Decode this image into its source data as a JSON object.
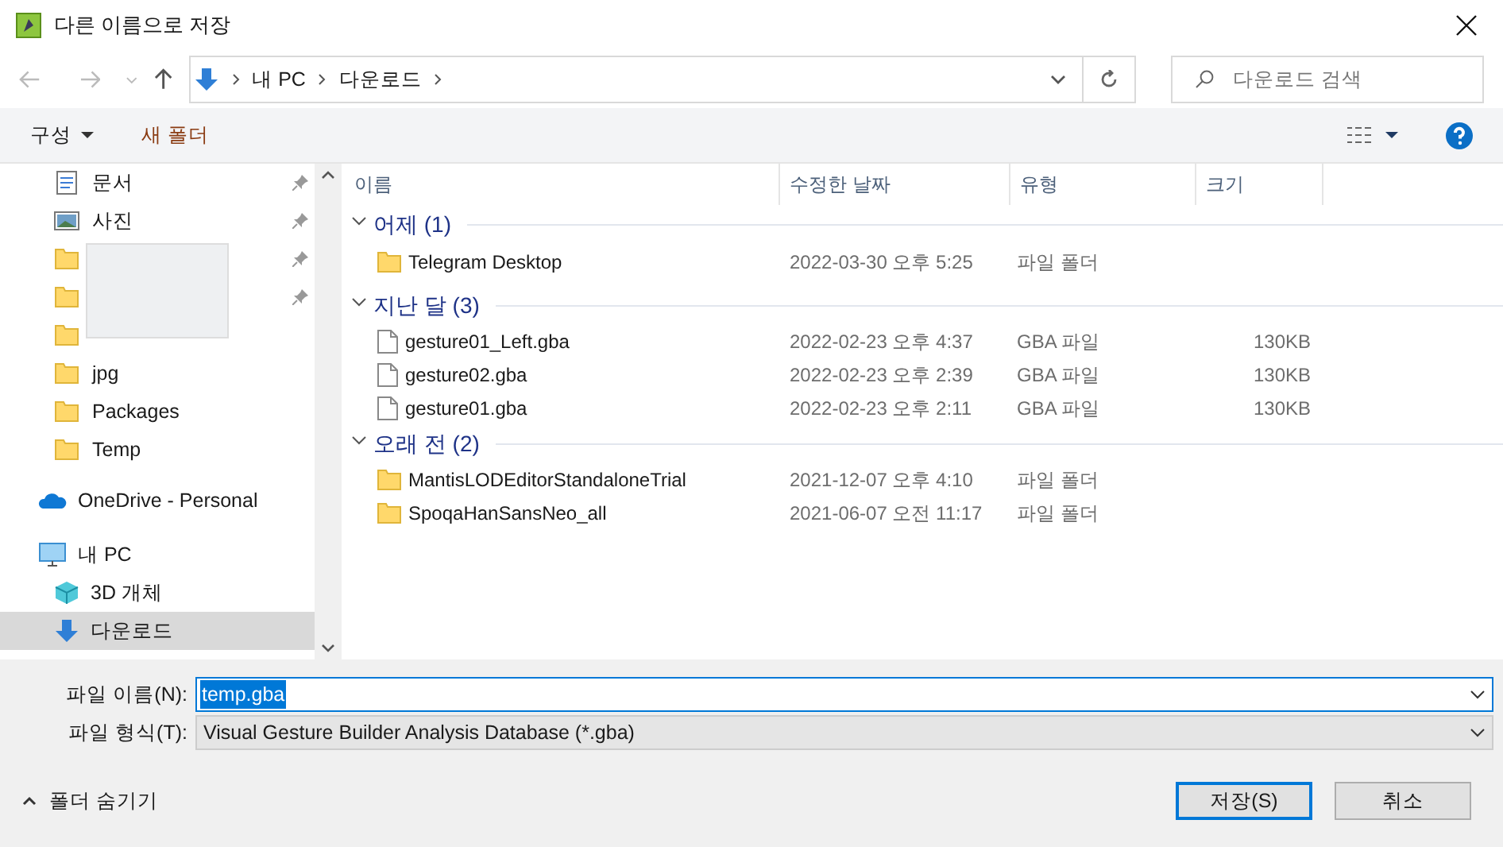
{
  "window": {
    "title": "다른 이름으로 저장"
  },
  "address_bar": {
    "path": [
      "내 PC",
      "다운로드"
    ]
  },
  "search": {
    "placeholder": "다운로드 검색"
  },
  "toolbar": {
    "organize": "구성",
    "new_folder": "새 폴더"
  },
  "quick_access": [
    {
      "label": "문서",
      "kind": "documents",
      "pinned": true
    },
    {
      "label": "사진",
      "kind": "pictures",
      "pinned": true
    },
    {
      "kind": "folder",
      "pinned": true
    },
    {
      "kind": "folder",
      "pinned": true
    },
    {
      "kind": "folder",
      "pinned": false
    },
    {
      "label": "jpg",
      "kind": "folder",
      "pinned": false
    },
    {
      "label": "Packages",
      "kind": "folder",
      "pinned": false
    },
    {
      "label": "Temp",
      "kind": "folder",
      "pinned": false
    }
  ],
  "sidebar": {
    "items": [
      {
        "label": "OneDrive - Personal",
        "kind": "cloud",
        "selected": false
      },
      {
        "label": "내 PC",
        "kind": "pc",
        "selected": false,
        "children": [
          {
            "label": "3D 개체",
            "kind": "cube",
            "selected": false
          },
          {
            "label": "다운로드",
            "kind": "download",
            "selected": true
          }
        ]
      }
    ]
  },
  "table": {
    "columns": [
      "이름",
      "수정한 날짜",
      "유형",
      "크기"
    ],
    "groups": [
      {
        "title": "어제 (1)",
        "expanded": true,
        "rows": [
          {
            "name": "Telegram Desktop",
            "kind": "folder",
            "date": "2022-03-30 오후 5:25",
            "type": "파일 폴더"
          }
        ]
      },
      {
        "title": "지난 달 (3)",
        "expanded": true,
        "rows": [
          {
            "name": "gesture01_Left.gba",
            "kind": "file",
            "date": "2022-02-23 오후 4:37",
            "type": "GBA 파일",
            "size": "130KB"
          },
          {
            "name": "gesture02.gba",
            "kind": "file",
            "date": "2022-02-23 오후 2:39",
            "type": "GBA 파일",
            "size": "130KB"
          },
          {
            "name": "gesture01.gba",
            "kind": "file",
            "date": "2022-02-23 오후 2:11",
            "type": "GBA 파일",
            "size": "130KB"
          }
        ]
      },
      {
        "title": "오래 전 (2)",
        "expanded": true,
        "rows": [
          {
            "name": "MantisLODEditorStandaloneTrial",
            "kind": "folder",
            "date": "2021-12-07 오후 4:10",
            "type": "파일 폴더"
          },
          {
            "name": "SpoqaHanSansNeo_all",
            "kind": "folder",
            "date": "2021-06-07 오전 11:17",
            "type": "파일 폴더"
          }
        ]
      }
    ]
  },
  "file_name": {
    "label": "파일 이름(N):",
    "value": "temp.gba"
  },
  "file_type": {
    "label": "파일 형식(T):",
    "value": "Visual Gesture Builder Analysis Database (*.gba)"
  },
  "hide_folders": "폴더 숨기기",
  "buttons": [
    {
      "label": "저장(S)",
      "default": true
    },
    {
      "label": "취소",
      "default": false
    }
  ]
}
